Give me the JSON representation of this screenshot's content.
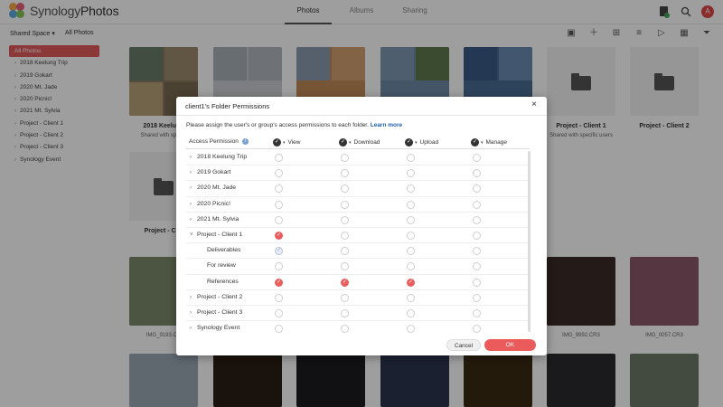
{
  "app": {
    "logo_main": "Synology",
    "logo_sub": "Photos"
  },
  "tabs": [
    {
      "label": "Photos",
      "active": true
    },
    {
      "label": "Albums",
      "active": false
    },
    {
      "label": "Sharing",
      "active": false
    }
  ],
  "user": {
    "avatar_letter": "A"
  },
  "subbar": {
    "space": "Shared Space",
    "view": "All Photos"
  },
  "sidebar": {
    "items": [
      {
        "label": "All Photos",
        "active": true
      },
      {
        "label": "2018 Keelung Trip"
      },
      {
        "label": "2019 Gokart"
      },
      {
        "label": "2020 Mt. Jade"
      },
      {
        "label": "2020 Picnic!"
      },
      {
        "label": "2021 Mt. Sylvia"
      },
      {
        "label": "Project - Client 1"
      },
      {
        "label": "Project - Client 2"
      },
      {
        "label": "Project - Client 3"
      },
      {
        "label": "Synology Event"
      }
    ]
  },
  "grid": {
    "tile1_label": "2018 Keelung",
    "tile1_sub": "Shared with specif",
    "tile5_label": "Project - Client 1",
    "tile5_sub": "Shared with specific users",
    "tile6_label": "Project - Client 2",
    "tile7_label": "Project - Clie",
    "photo1": "IMG_9193.CR",
    "photo2": "IMG_9992.CR3",
    "photo3": "IMG_0057.CR3"
  },
  "modal": {
    "title": "client1's Folder Permissions",
    "close": "×",
    "description": "Please assign the user's or group's access permissions to each folder.",
    "learn_more": "Learn more",
    "columns": [
      "Access Permission",
      "View",
      "Download",
      "Upload",
      "Manage"
    ],
    "rows": [
      {
        "name": "2018 Keelung Trip",
        "indent": 0,
        "chev": "›",
        "perms": [
          0,
          0,
          0,
          0
        ]
      },
      {
        "name": "2019 Gokart",
        "indent": 0,
        "chev": "›",
        "perms": [
          0,
          0,
          0,
          0
        ]
      },
      {
        "name": "2020 Mt. Jade",
        "indent": 0,
        "chev": "›",
        "perms": [
          0,
          0,
          0,
          0
        ]
      },
      {
        "name": "2020 Picnic!",
        "indent": 0,
        "chev": "›",
        "perms": [
          0,
          0,
          0,
          0
        ]
      },
      {
        "name": "2021 Mt. Sylvia",
        "indent": 0,
        "chev": "›",
        "perms": [
          0,
          0,
          0,
          0
        ]
      },
      {
        "name": "Project - Client 1",
        "indent": 0,
        "chev": "˅",
        "perms": [
          1,
          0,
          0,
          0
        ]
      },
      {
        "name": "Deliverables",
        "indent": 1,
        "chev": "",
        "perms": [
          2,
          0,
          0,
          0
        ]
      },
      {
        "name": "For review",
        "indent": 1,
        "chev": "",
        "perms": [
          0,
          0,
          0,
          0
        ]
      },
      {
        "name": "References",
        "indent": 1,
        "chev": "",
        "perms": [
          1,
          1,
          1,
          0
        ]
      },
      {
        "name": "Project - Client 2",
        "indent": 0,
        "chev": "›",
        "perms": [
          0,
          0,
          0,
          0
        ]
      },
      {
        "name": "Project - Client 3",
        "indent": 0,
        "chev": "›",
        "perms": [
          0,
          0,
          0,
          0
        ]
      },
      {
        "name": "Synology Event",
        "indent": 0,
        "chev": "›",
        "perms": [
          0,
          0,
          0,
          0
        ]
      }
    ],
    "cancel_label": "Cancel",
    "ok_label": "OK"
  },
  "colors": {
    "accent": "#e85d5d",
    "link": "#1e5fa8"
  }
}
